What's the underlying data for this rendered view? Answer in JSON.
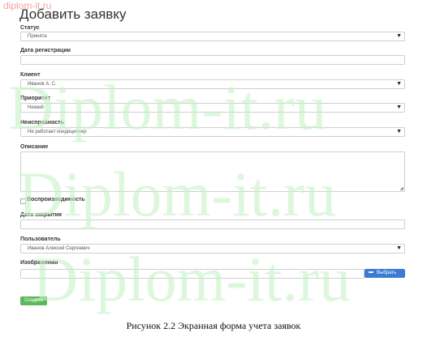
{
  "site_watermark": "diplom-it.ru",
  "page_watermark": "Diplom-it.ru",
  "form": {
    "title": "Добавить заявку",
    "status": {
      "label": "Статус",
      "value": "Принята"
    },
    "registration_date": {
      "label": "Дата регистрации",
      "value": ""
    },
    "client": {
      "label": "Клиент",
      "value": "Иванов А. С."
    },
    "priority": {
      "label": "Приоритет",
      "value": "Низкий"
    },
    "fault": {
      "label": "Неисправность",
      "value": "Не работает кондиционер"
    },
    "description": {
      "label": "Описание",
      "value": ""
    },
    "reproducible": {
      "label": "Воспроизводимость",
      "checked": false
    },
    "close_date": {
      "label": "Дата закрытия",
      "value": ""
    },
    "user": {
      "label": "Пользователь",
      "value": "Иванов Алексей Сергеевич"
    },
    "images": {
      "label": "Изображения",
      "browse_label": "Выбрать"
    },
    "save_label": "Создать"
  },
  "caption": "Рисунок 2.2 Экранная форма учета заявок",
  "icons": {
    "dropdown": "chevron-down-icon",
    "browse": "folder-icon",
    "resize": "resize-handle-icon"
  },
  "colors": {
    "save_button": "#5cb85c",
    "browse_button": "#3a7bd5",
    "watermark": "#c8f3c8"
  }
}
